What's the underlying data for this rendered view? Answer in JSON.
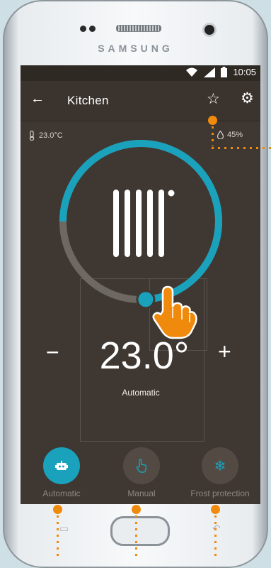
{
  "device": {
    "brand": "SAMSUNG"
  },
  "status_bar": {
    "time": "10:05",
    "icons": [
      "wifi-icon",
      "signal-icon",
      "battery-icon"
    ]
  },
  "app_bar": {
    "back_icon": "arrow-left-icon",
    "title": "Kitchen",
    "actions": [
      "star-icon",
      "gear-icon"
    ]
  },
  "readings": {
    "room_temperature": "23.0°C",
    "humidity": "45%"
  },
  "thermostat": {
    "setpoint": "23.0°",
    "mode_label": "Automatic",
    "decrease_label": "−",
    "increase_label": "+",
    "level_fraction": 0.74
  },
  "modes": [
    {
      "label": "Automatic",
      "icon": "robot-icon",
      "active": true
    },
    {
      "label": "Manual",
      "icon": "hand-icon",
      "active": false
    },
    {
      "label": "Frost protection",
      "icon": "snowflake-icon",
      "active": false
    }
  ],
  "colors": {
    "accent": "#1aa2bc",
    "screen_bg": "#3f3832",
    "appbar_bg": "#3a332e",
    "annotation": "#f08a0c",
    "ring_inactive": "#6e6863"
  }
}
